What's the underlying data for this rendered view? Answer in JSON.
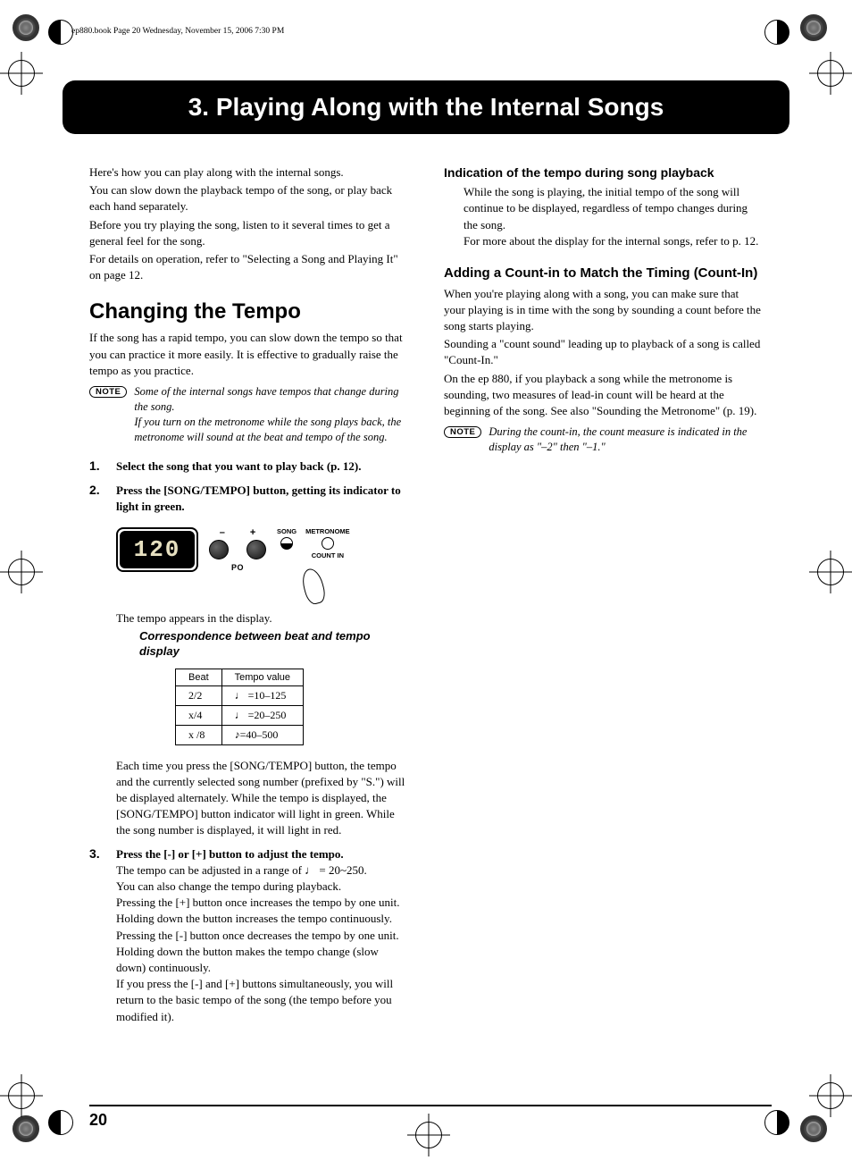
{
  "header_line": "ep880.book  Page 20  Wednesday, November 15, 2006  7:30 PM",
  "chapter_title": "3. Playing Along with the Internal Songs",
  "intro_paragraphs": [
    "Here's how you can play along with the internal songs.",
    "You can slow down the playback tempo of the song, or play back each hand separately.",
    "Before you try playing the song, listen to it several times to get a general feel for the song.",
    "For details on operation, refer to \"Selecting a Song and Playing It\" on page 12."
  ],
  "section_changing_tempo": {
    "heading": "Changing the Tempo",
    "text": "If the song has a rapid tempo, you can slow down the tempo so that you can practice it more easily. It is effective to gradually raise the tempo as you practice.",
    "note_label": "NOTE",
    "note_text": "Some of the internal songs have tempos that change during the song.\nIf you turn on the metronome while the song plays back, the metronome will sound at the beat and tempo of the song.",
    "steps": {
      "s1": {
        "num": "1.",
        "title": "Select the song that you want to play back (p. 12)."
      },
      "s2": {
        "num": "2.",
        "title": "Press the [SONG/TEMPO] button, getting its indicator to light in green."
      },
      "caption_after_illus": "The tempo appears in the display.",
      "subhead": "Correspondence between beat and tempo display",
      "after_table": "Each time you press the [SONG/TEMPO] button, the tempo and the currently selected song number (prefixed by \"S.\") will be displayed alternately. While the tempo is displayed, the [SONG/TEMPO] button indicator will light in green. While the song number is displayed, it will light in red.",
      "s3": {
        "num": "3.",
        "title": "Press the [-] or [+] button to adjust the tempo.",
        "p1": "The tempo can be adjusted in a range of ♩    = 20~250.",
        "p2": "You can also change the tempo during playback.",
        "p3": "Pressing the [+] button once increases the tempo by one unit. Holding down the button increases the tempo continuously.",
        "p4": "Pressing the [-] button once decreases the tempo by one unit. Holding down the button makes the tempo change (slow down) continuously.",
        "p5": "If you press the [-] and [+] buttons simultaneously, you will return to the basic tempo of the song (the tempo before you modified it)."
      }
    },
    "tempo_table": {
      "head_beat": "Beat",
      "head_value": "Tempo value",
      "rows": [
        {
          "beat": "2/2",
          "value": "♩ =10–125"
        },
        {
          "beat": "x/4",
          "value": "♩ =20–250"
        },
        {
          "beat": "x /8",
          "value": "♪=40–500"
        }
      ]
    },
    "illus": {
      "lcd": "120",
      "minus": "–",
      "plus": "+",
      "song": "SONG",
      "tempo_small": "PO",
      "metronome": "METRONOME",
      "countin": "COUNT IN"
    }
  },
  "section_indication": {
    "heading": "Indication of the tempo during song playback",
    "p1": "While the song is playing, the initial tempo of the song will continue to be displayed, regardless of tempo changes during the song.",
    "p2": "For more about the display for the internal songs, refer to p. 12."
  },
  "section_countin": {
    "heading": "Adding a Count-in to Match the Timing (Count-In)",
    "p1": "When you're playing along with a song, you can make sure that your playing is in time with the song by sounding a count before the song starts playing.",
    "p2": "Sounding a \"count sound\" leading up to playback of a song is called \"Count-In.\"",
    "p3": "On the ep 880, if you playback a song while the metronome is sounding, two measures of lead-in count will be heard at the beginning of the song. See also \"Sounding the Metronome\" (p. 19).",
    "note_label": "NOTE",
    "note_text": "During the count-in, the count measure is indicated in the display as \"–2\" then \"–1.\""
  },
  "page_number": "20"
}
